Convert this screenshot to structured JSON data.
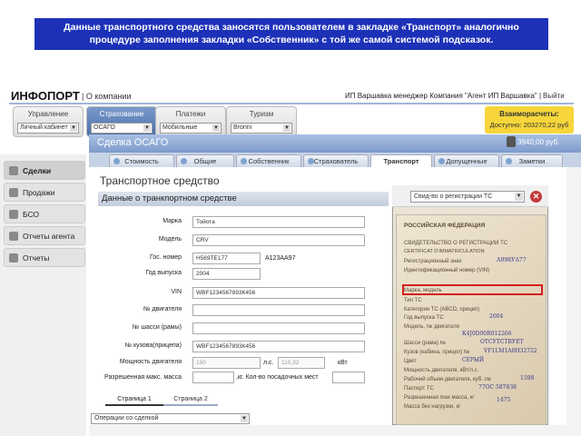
{
  "banner": {
    "line1": "Данные транспортного средства заносятся пользователем в закладке «Транспорт» аналогично",
    "line2": "процедуре заполнения закладки «Собственник» с той же самой системой подсказок."
  },
  "app": {
    "logo": "ИНФОПОРТ",
    "about_link": "| О компании",
    "user_info": "ИП Варшавка менеджер Компания \"Агент ИП Варшавка\" |",
    "logout": "Выйти"
  },
  "topmenu": [
    {
      "label": "Управление",
      "value": "Личный кабинет"
    },
    {
      "label": "Страхование",
      "value": "ОСАГО"
    },
    {
      "label": "Платежи",
      "value": "Мобильные"
    },
    {
      "label": "Туризм",
      "value": "Bronni"
    }
  ],
  "mutual": {
    "title": "Взаиморасчеты:",
    "available": "Доступно: 203270,22 руб"
  },
  "sidebar": {
    "items": [
      {
        "label": "Сделки"
      },
      {
        "label": "Продажи"
      },
      {
        "label": "БСО"
      },
      {
        "label": "Отчеты агента"
      },
      {
        "label": "Отчеты"
      }
    ]
  },
  "deal": {
    "title": "Сделка ОСАГО",
    "amount": "3940,00 руб."
  },
  "tabs": [
    {
      "label": "Стоимость"
    },
    {
      "label": "Общие"
    },
    {
      "label": "Собственник"
    },
    {
      "label": "Страхователь"
    },
    {
      "label": "Транспорт"
    },
    {
      "label": "Допущенные"
    },
    {
      "label": "Заметки"
    }
  ],
  "panel": {
    "title": "Транспортное средство",
    "subheader": "Данные о транкпортном средстве"
  },
  "form": {
    "make": {
      "label": "Марка",
      "value": "Тойота"
    },
    "model": {
      "label": "Модель",
      "value": "CRV"
    },
    "plate": {
      "label": "Гос. номер",
      "value": "Н569ТЕ177",
      "extra": "A123AA97"
    },
    "year": {
      "label": "Год выпуска",
      "value": "2004"
    },
    "vin": {
      "label": "VIN",
      "value": "WBF1234567893К456"
    },
    "engine": {
      "label": "№ двигателя",
      "value": ""
    },
    "chassis": {
      "label": "№ шасси (рамы)",
      "value": ""
    },
    "body": {
      "label": "№ кузова(прицепа)",
      "value": "WBF1234567893К456"
    },
    "power": {
      "label": "Мощность двигателя",
      "value": "150",
      "unit1": "л.с.",
      "value2": "110,32",
      "unit2": "кВт"
    },
    "mass": {
      "label": "Разрешенная макс. масса",
      "value": "",
      "seats_label": ",кг. Кол-во посадочных мест",
      "seats": ""
    }
  },
  "pagetabs": [
    {
      "label": "Страница 1"
    },
    {
      "label": "Страница 2"
    }
  ],
  "operations": {
    "value": "Операции со сделкой"
  },
  "overlay": {
    "doctype": "Свид-во о регистрации ТС",
    "close": "✕"
  },
  "doc": {
    "l1": "РОССИЙСКАЯ ФЕДЕРАЦИЯ",
    "l2": "СВИДЕТЕЛЬСТВО О РЕГИСТРАЦИИ ТС",
    "l3": "CERTIFICAT D'IMMATRICULATION",
    "l4": "Регистрационный знак",
    "l5": "Идентификационный номер (VIN)",
    "l6": "Марка, модель",
    "l7": "Тип ТС",
    "l8": "Категория ТС (ABCD, прицеп)",
    "l9": "Год выпуска ТС",
    "l10": "Модель, № двигателя",
    "l11": "Шасси (рама) №",
    "l12": "Кузов (кабина, прицеп) №",
    "l13": "Цвет",
    "l14": "Мощность двигателя, кВт/л.с.",
    "l15": "Рабочий объем двигателя, куб. см",
    "l16": "Паспорт ТС",
    "l17": "Разрешенная max масса, кг",
    "l18": "Масса без нагрузки, кг",
    "h1": "А998УА77",
    "h2": "2004",
    "h3": "К4J0D00R012266",
    "h4": "ОТСУТСТВУЕТ",
    "h5": "VF1LM1A0H32722",
    "h6": "СЕРЫЙ",
    "h7": "1598",
    "h8": "77ОС 587838",
    "h9": "1475"
  }
}
